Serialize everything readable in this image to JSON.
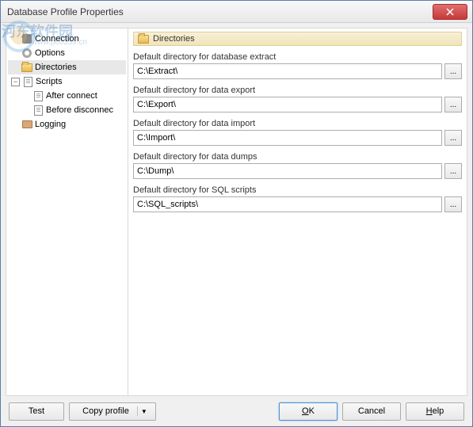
{
  "window": {
    "title": "Database Profile Properties"
  },
  "tree": {
    "items": [
      {
        "label": "Connection"
      },
      {
        "label": "Options"
      },
      {
        "label": "Directories"
      },
      {
        "label": "Scripts"
      },
      {
        "label": "After connect"
      },
      {
        "label": "Before disconnec"
      },
      {
        "label": "Logging"
      }
    ]
  },
  "panel": {
    "header": "Directories",
    "fields": [
      {
        "label": "Default directory for database extract",
        "value": "C:\\Extract\\"
      },
      {
        "label": "Default directory for data export",
        "value": "C:\\Export\\"
      },
      {
        "label": "Default directory for data import",
        "value": "C:\\Import\\"
      },
      {
        "label": "Default directory for data dumps",
        "value": "C:\\Dump\\"
      },
      {
        "label": "Default directory for SQL scripts",
        "value": "C:\\SQL_scripts\\"
      }
    ],
    "browse": "..."
  },
  "footer": {
    "test": "Test",
    "copy": "Copy profile",
    "ok": "OK",
    "cancel": "Cancel",
    "help": "Help"
  },
  "watermark": {
    "main": "河东软件园",
    "sub": "www.pc0359.cn"
  }
}
